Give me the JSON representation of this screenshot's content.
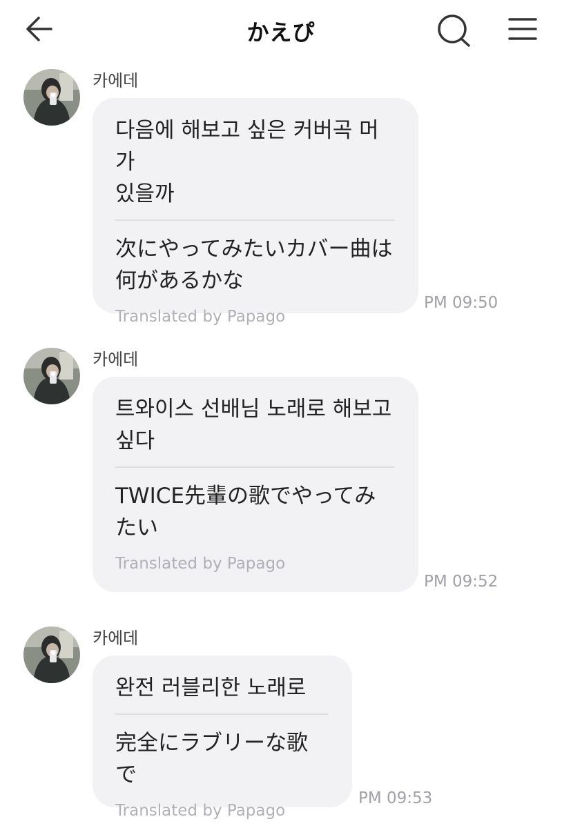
{
  "header": {
    "title": "かえぴ",
    "back_icon": "arrow-left-icon",
    "search_icon": "search-icon",
    "menu_icon": "hamburger-menu-icon"
  },
  "messages": [
    {
      "sender": "카에데",
      "original": "다음에 해보고 싶은 커버곡 머가\n있을까",
      "translation": "次にやってみたいカバー曲は\n何があるかな",
      "translated_by": "Translated by Papago",
      "time": "PM 09:50"
    },
    {
      "sender": "카에데",
      "original": "트와이스 선배님 노래로 해보고\n싶다",
      "translation": "TWICE先輩の歌でやってみ\nたい",
      "translated_by": "Translated by Papago",
      "time": "PM 09:52"
    },
    {
      "sender": "카에데",
      "original": "완전 러블리한 노래로",
      "translation": "完全にラブリーな歌で",
      "translated_by": "Translated by Papago",
      "time": "PM 09:53"
    }
  ],
  "colors": {
    "bubble": "#f2f2f4",
    "divider": "#dedee2",
    "timestamp": "#a0a0a8",
    "papago_note": "#b0b0b8"
  }
}
